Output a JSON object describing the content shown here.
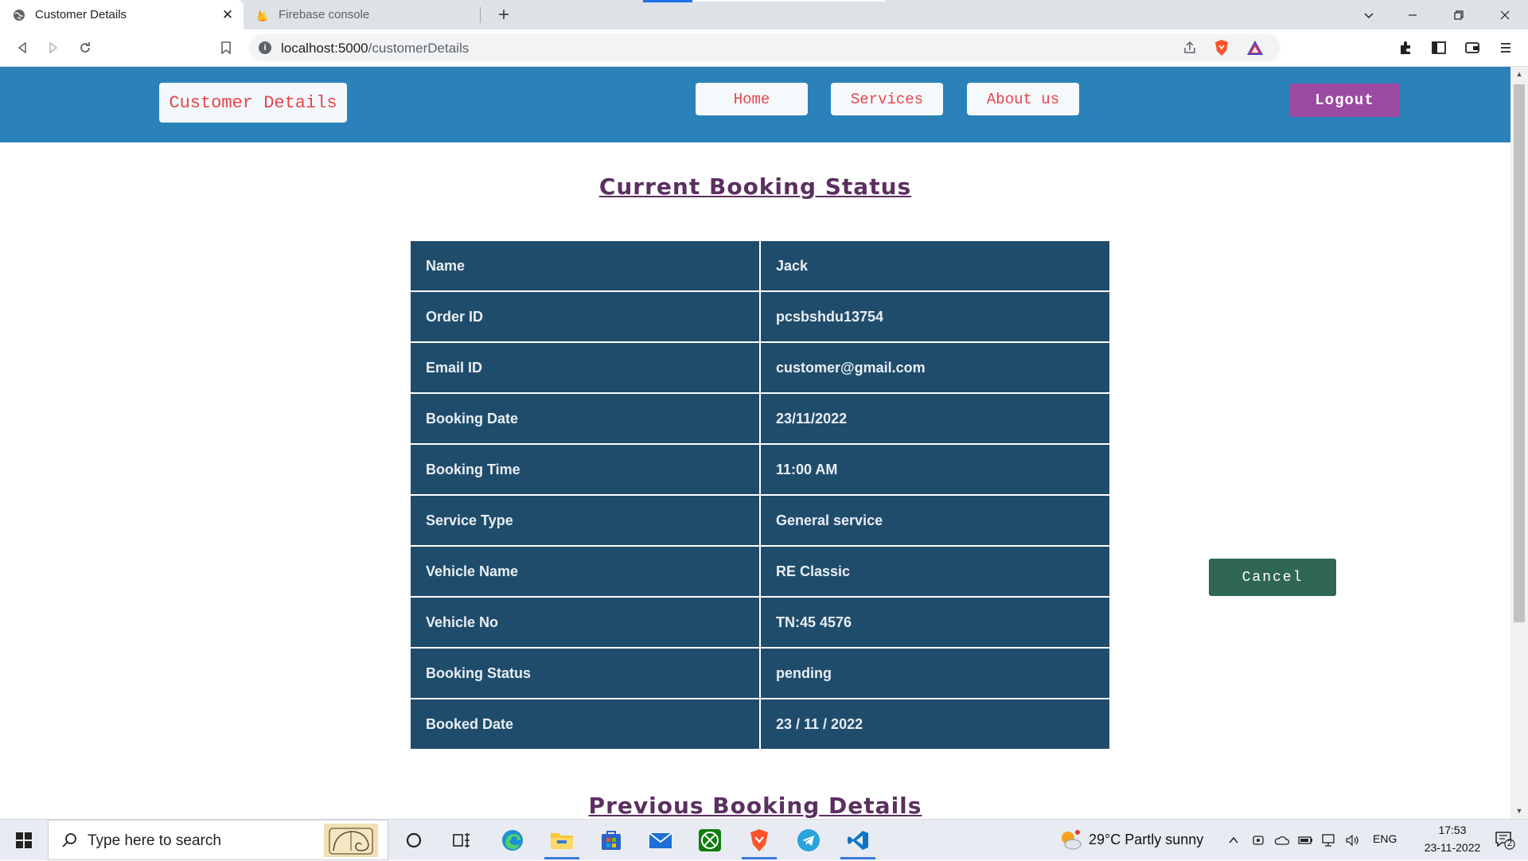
{
  "browser": {
    "tabs": [
      {
        "title": "Customer Details",
        "active": true
      },
      {
        "title": "Firebase console",
        "active": false
      }
    ],
    "url_host": "localhost:5000",
    "url_path": "/customerDetails"
  },
  "nav": {
    "brand": "Customer Details",
    "links": [
      "Home",
      "Services",
      "About us"
    ],
    "logout": "Logout"
  },
  "main": {
    "heading": "Current Booking Status",
    "rows": [
      {
        "label": "Name",
        "value": "Jack"
      },
      {
        "label": "Order ID",
        "value": "pcsbshdu13754"
      },
      {
        "label": "Email ID",
        "value": "customer@gmail.com"
      },
      {
        "label": "Booking Date",
        "value": "23/11/2022"
      },
      {
        "label": "Booking Time",
        "value": "11:00 AM"
      },
      {
        "label": "Service Type",
        "value": "General service"
      },
      {
        "label": "Vehicle Name",
        "value": "RE Classic"
      },
      {
        "label": "Vehicle No",
        "value": "TN:45 4576"
      },
      {
        "label": "Booking Status",
        "value": "pending"
      },
      {
        "label": "Booked Date",
        "value": "23 / 11 / 2022"
      }
    ],
    "cancel_label": "Cancel",
    "previous_heading": "Previous Booking Details"
  },
  "taskbar": {
    "search_placeholder": "Type here to search",
    "weather": "29°C  Partly sunny",
    "language": "ENG",
    "time": "17:53",
    "date": "23-11-2022",
    "notifications": "2"
  },
  "colors": {
    "navbar": "#2b82b9",
    "table": "#204c6c",
    "heading": "#5a3060",
    "logout": "#9b4aa2",
    "cancel": "#2f6656",
    "link_text": "#e8454a"
  }
}
